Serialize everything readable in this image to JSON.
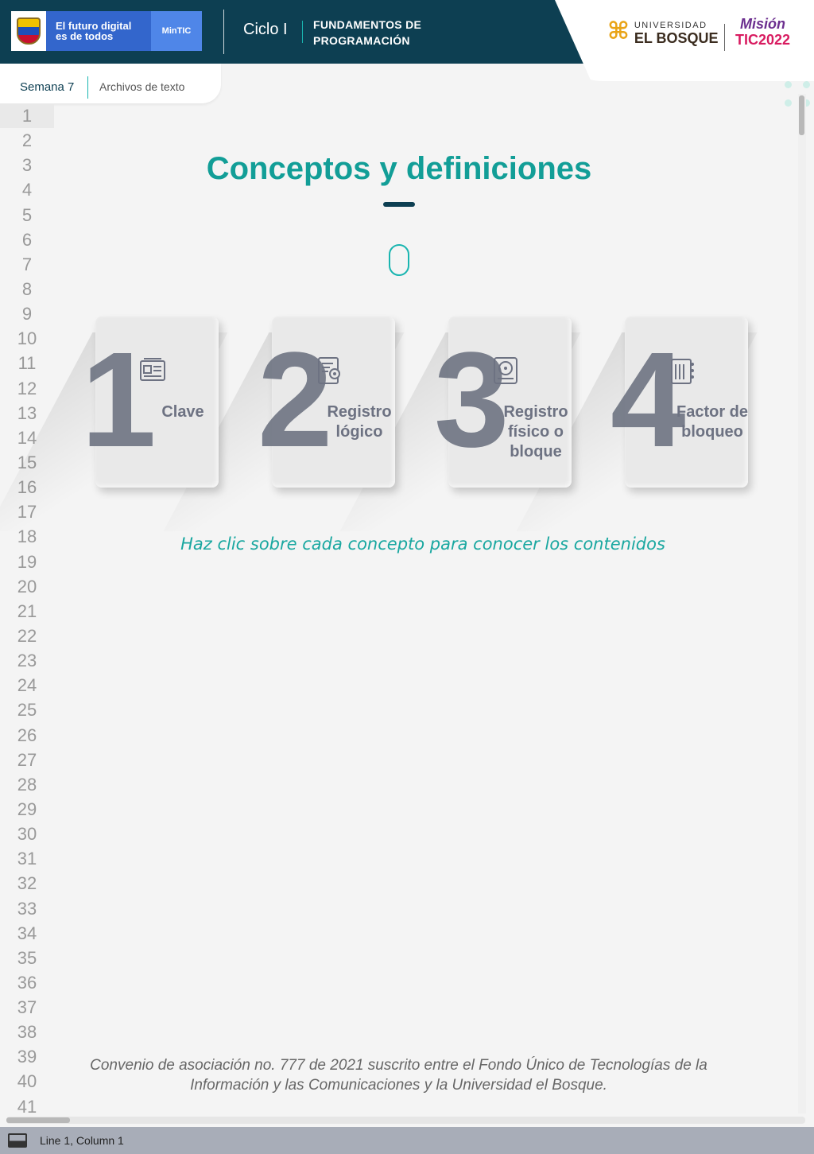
{
  "header": {
    "gov_slogan": "El futuro digital es de todos",
    "gov_badge": "MinTIC",
    "cycle": "Ciclo I",
    "course": [
      "FUNDAMENTOS DE",
      "PROGRAMACIÓN"
    ],
    "university_small": "UNIVERSIDAD",
    "university_big": "EL BOSQUE",
    "mission_top": "Misión",
    "mission_bottom": "TIC2022"
  },
  "breadcrumb": {
    "week": "Semana 7",
    "topic": "Archivos de texto"
  },
  "editor": {
    "line_numbers": [
      "1",
      "2",
      "3",
      "4",
      "5",
      "6",
      "7",
      "8",
      "9",
      "10",
      "11",
      "12",
      "13",
      "14",
      "15",
      "16",
      "17",
      "18",
      "19",
      "20",
      "21",
      "22",
      "23",
      "24",
      "25",
      "26",
      "27",
      "28",
      "29",
      "30",
      "31",
      "32",
      "33",
      "34",
      "35",
      "36",
      "37",
      "38",
      "39",
      "40",
      "41"
    ],
    "active_line": "1"
  },
  "content": {
    "title": "Conceptos y definiciones",
    "cards": [
      {
        "number": "1",
        "label": "Clave",
        "icon": "id-card-icon"
      },
      {
        "number": "2",
        "label": "Registro lógico",
        "icon": "document-gear-icon"
      },
      {
        "number": "3",
        "label": "Registro físico o bloque",
        "icon": "hard-disk-icon"
      },
      {
        "number": "4",
        "label": "Factor de bloqueo",
        "icon": "data-document-icon"
      }
    ],
    "hint": "Haz clic sobre cada concepto para conocer los contenidos",
    "footer": "Convenio de asociación no. 777 de 2021 suscrito entre el Fondo Único de Tecnologías de la Información y las Comunicaciones y la Universidad el Bosque."
  },
  "status_bar": {
    "position": "Line 1, Column 1"
  },
  "colors": {
    "header_bg": "#0d3f52",
    "accent_teal": "#129e97",
    "gov_blue": "#3366cc",
    "card_number": "#6e7482"
  }
}
